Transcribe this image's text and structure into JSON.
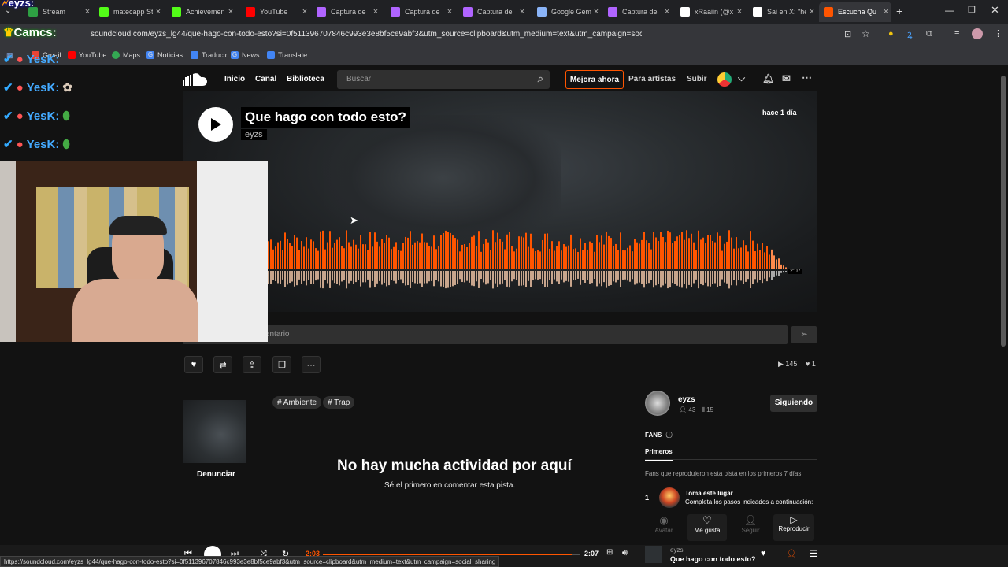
{
  "browser": {
    "tabs": [
      {
        "label": "Stream",
        "fav": "#2ea043"
      },
      {
        "label": "matecapp St",
        "fav": "#53fc18"
      },
      {
        "label": "Achievemen",
        "fav": "#53fc18"
      },
      {
        "label": "YouTube",
        "fav": "#ff0000"
      },
      {
        "label": "Captura de",
        "fav": "#b064ff"
      },
      {
        "label": "Captura de",
        "fav": "#b064ff"
      },
      {
        "label": "Captura de",
        "fav": "#b064ff"
      },
      {
        "label": "Google Gem",
        "fav": "#8ab4f8"
      },
      {
        "label": "Captura de",
        "fav": "#b064ff"
      },
      {
        "label": "xRaaiin (@x",
        "fav": "#ffffff"
      },
      {
        "label": "Sai en X: \"he",
        "fav": "#ffffff"
      },
      {
        "label": "Escucha Qu",
        "fav": "#ff5500"
      }
    ],
    "new_tab": "+",
    "url": "soundcloud.com/eyzs_lg44/que-hago-con-todo-esto?si=0f511396707846c993e3e8bf5ce9abf3&utm_source=clipboard&utm_medium=text&utm_campaign=social_sharing",
    "bookmarks": [
      "Gmail",
      "YouTube",
      "Maps",
      "Noticias",
      "Traducir",
      "News",
      "Translate"
    ],
    "status_url": "https://soundcloud.com/eyzs_lg44/que-hago-con-todo-esto?si=0f511396707846c993e3e8bf5ce9abf3&utm_source=clipboard&utm_medium=text&utm_campaign=social_sharing"
  },
  "overlay": {
    "chat_top_name": "eyzs:",
    "chat_second": "Camcs:",
    "chat_user": "YesK:"
  },
  "nav": {
    "inicio": "Inicio",
    "canal": "Canal",
    "biblioteca": "Biblioteca",
    "search_placeholder": "Buscar",
    "upgrade": "Mejora ahora",
    "artists": "Para artistas",
    "upload": "Subir"
  },
  "track": {
    "title": "Que hago con todo esto?",
    "artist": "eyzs",
    "posted": "hace 1 día",
    "duration": "2:07",
    "comment_placeholder": "Escribe un comentario",
    "plays": "145",
    "likes": "1",
    "tags": [
      "# Ambiente",
      "# Trap"
    ],
    "report": "Denunciar"
  },
  "activity": {
    "heading": "No hay mucha actividad por aquí",
    "sub": "Sé el primero en comentar esta pista."
  },
  "artist_panel": {
    "name": "eyzs",
    "followers": "43",
    "tracks": "15",
    "following_btn": "Siguiendo",
    "fans_label": "FANS",
    "fans_tab": "Primeros",
    "fans_desc": "Fans que reprodujeron esta pista en los primeros 7 días:",
    "rank": "1",
    "claim_title": "Toma este lugar",
    "claim_sub": "Completa los pasos indicados a continuación:",
    "steps": [
      "Avatar",
      "Me gusta",
      "Seguir",
      "Reproducir"
    ]
  },
  "player": {
    "elapsed": "2:03",
    "total": "2:07",
    "artist": "eyzs",
    "title": "Que hago con todo esto?",
    "progress": 0.968
  },
  "colors": {
    "accent": "#ff5500",
    "bg": "#121212"
  }
}
